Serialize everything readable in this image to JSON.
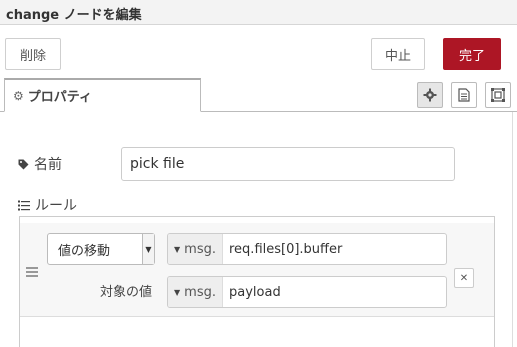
{
  "title": "change ノードを編集",
  "toolbar": {
    "delete_label": "削除",
    "cancel_label": "中止",
    "done_label": "完了"
  },
  "tabs": [
    {
      "label": "プロパティ",
      "icon": "gear-icon"
    }
  ],
  "side_buttons": [
    "gear-icon",
    "document-icon",
    "frame-icon"
  ],
  "fields": {
    "name_label": "名前",
    "name_value": "pick file",
    "rules_label": "ルール"
  },
  "rules": [
    {
      "action": "値の移動",
      "from_type": "msg.",
      "from_value": "req.files[0].buffer",
      "to_label": "対象の値",
      "to_type": "msg.",
      "to_value": "payload"
    }
  ],
  "colors": {
    "done_button": "#ad1625",
    "title_bar": "#f3f3f3"
  }
}
